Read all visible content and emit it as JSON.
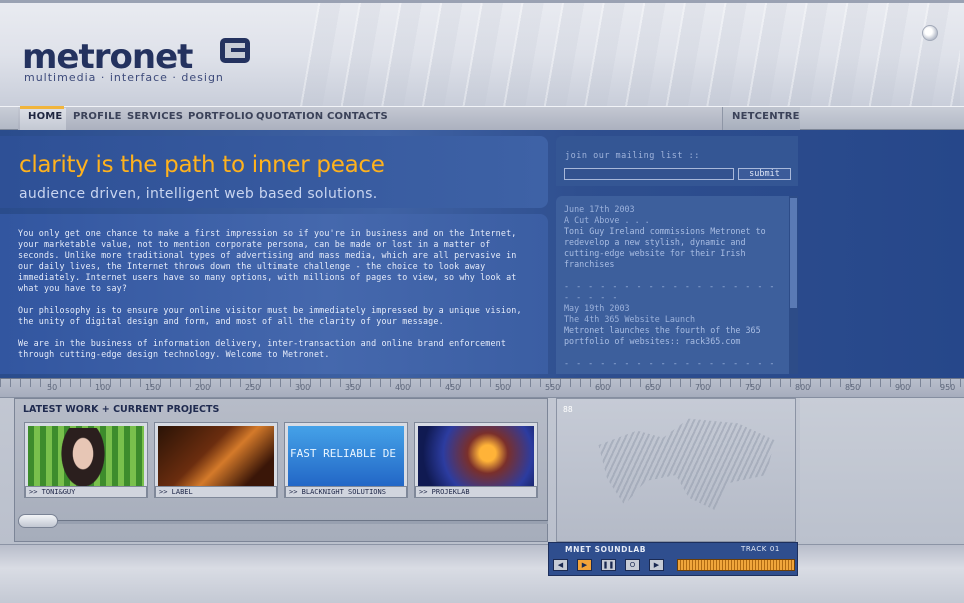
{
  "brand": {
    "name": "metronet",
    "tagline": "multimedia · interface · design"
  },
  "nav": {
    "items": [
      {
        "label": "HOME",
        "active": true
      },
      {
        "label": "PROFILE",
        "active": false
      },
      {
        "label": "SERVICES",
        "active": false
      },
      {
        "label": "PORTFOLIO",
        "active": false
      },
      {
        "label": "QUOTATION",
        "active": false
      },
      {
        "label": "CONTACTS",
        "active": false
      }
    ],
    "netcentre": "NETCENTRE"
  },
  "hero": {
    "title": "clarity is the path to inner peace",
    "subtitle": "audience driven, intelligent web based solutions."
  },
  "body": {
    "paragraphs": [
      "You only get one chance to make a first impression so if you're in business and on the Internet, your marketable value, not to mention corporate persona, can be made or lost in a matter of seconds.  Unlike more traditional types of advertising and mass media, which are all pervasive in our daily lives, the Internet throws down the ultimate challenge - the choice to look away immediately.  Internet users have so many options, with millions of pages to view, so why look at what you have to say?",
      "Our philosophy is to ensure your online visitor must be immediately impressed by a unique vision, the unity of digital design and form, and most of all the clarity of your message.",
      "We are in the business of information delivery, inter-transaction and online brand enforcement through cutting-edge design technology.  Welcome to Metronet."
    ]
  },
  "mailing": {
    "label": "join our mailing list ::",
    "input_value": "",
    "submit_label": "submit"
  },
  "news": [
    {
      "date": "June 17th 2003",
      "headline": "A Cut Above . . .",
      "text": "Toni Guy Ireland commissions Metronet to redevelop a new stylish, dynamic and cutting-edge website for their Irish franchises"
    },
    {
      "date": "May 19th 2003",
      "headline": "The 4th 365 Website Launch",
      "text": "Metronet launches the fourth of the 365 portfolio of websites:: rack365.com"
    }
  ],
  "news_separator": "- - - - - - - - - - - - - - - - - - - - - - -",
  "ruler": [
    "50",
    "100",
    "150",
    "200",
    "250",
    "300",
    "350",
    "400",
    "450",
    "500",
    "550",
    "600",
    "650",
    "700",
    "750",
    "800",
    "850",
    "900",
    "950"
  ],
  "projects": {
    "title": "LATEST WORK + CURRENT PROJECTS",
    "items": [
      {
        "label": ">> TONI&GUY"
      },
      {
        "label": ">> LABEL"
      },
      {
        "label": ">> BLACKNIGHT SOLUTIONS",
        "thumb_text": "FAST RELIABLE DE"
      },
      {
        "label": ">> PROJEKLAB"
      }
    ]
  },
  "map": {
    "number": "88"
  },
  "soundlab": {
    "title": "MNET SOUNDLAB",
    "track": "TRACK 01",
    "buttons": [
      {
        "icon": "previous-icon",
        "glyph": "◀"
      },
      {
        "icon": "play-icon",
        "glyph": "▶"
      },
      {
        "icon": "pause-icon",
        "glyph": "❚❚"
      },
      {
        "icon": "stop-icon",
        "glyph": "O"
      },
      {
        "icon": "next-icon",
        "glyph": "▶"
      }
    ]
  },
  "colors": {
    "accent": "#ffb21d",
    "brand_navy": "#24325f",
    "panel_blue": "#3256a0"
  }
}
